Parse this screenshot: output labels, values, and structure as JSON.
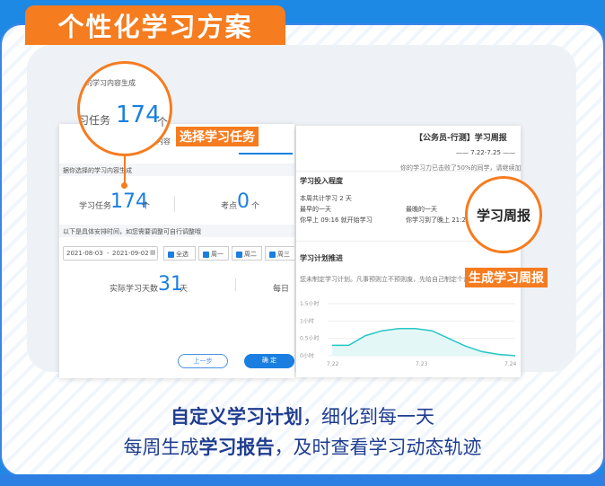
{
  "header": {
    "title": "个性化学习方案"
  },
  "left_screen": {
    "section_title": "据你选择的学习内容生成",
    "tab_partial": "内容",
    "task_label": "学习任务",
    "task_value": "174",
    "task_unit": "个",
    "points_label": "考点",
    "points_value": "0",
    "points_unit": "个",
    "schedule_hint": "以下是具体安排时间，如您需要调整可自行调整哦",
    "date_start": "2021-08-03",
    "date_sep": "-",
    "date_end": "2021-09-02",
    "checkboxes": [
      "全选",
      "周一",
      "周二",
      "周三"
    ],
    "actual_days_label": "实际学习天数",
    "actual_days_value": "31",
    "actual_days_unit": "天",
    "daily_partial": "每日",
    "prev_button": "上一步",
    "confirm_button": "确 定"
  },
  "zoom_left": {
    "top_text": "的学习内容生成",
    "task_label": "习任务",
    "task_value": "174",
    "task_unit": "个"
  },
  "right_screen": {
    "title": "【公务员-行测】学习周报",
    "date_range": "—— 7.22-7.25 ——",
    "beat_text": "你的学习力已击败了50%的同学，请继续加",
    "section1_title": "学习投入程度",
    "week_total": "本周共计学习 2 天",
    "earliest_label": "最早的一天",
    "latest_label": "最晚的一天",
    "earliest_text": "你早上 09:16 就开始学习",
    "latest_text": "你学习到了晚上 21:28",
    "section2_title": "学习计划推进",
    "plan_text": "您未制定学习计划。凡事预则立不预则废，先给自己制定个合",
    "zoom_label": "学习周报"
  },
  "tags": {
    "select_task": "选择学习任务",
    "generate_report": "生成学习周报"
  },
  "captions": {
    "line1_bold": "自定义学习计划",
    "line1_rest": "，细化到每一天",
    "line2_pre": "每周生成",
    "line2_bold": "学习报告",
    "line2_rest": "，及时查看学习动态轨迹"
  },
  "chart_data": {
    "type": "area",
    "x": [
      "7.22",
      "7.23",
      "7.24"
    ],
    "y_ticks": [
      "1.5小时",
      "1小时",
      "0.5小时",
      "0小时"
    ],
    "ylim": [
      0,
      1.5
    ],
    "series": [
      {
        "values": [
          0.3,
          0.3,
          0.58,
          0.72,
          0.78,
          0.78,
          0.72,
          0.5,
          0.28,
          0.12,
          0.04,
          0.0
        ]
      }
    ],
    "line_color": "#26c6c6"
  },
  "colors": {
    "accent": "#f57c1f",
    "primary": "#1a7fe0",
    "caption": "#1f3d8f"
  }
}
